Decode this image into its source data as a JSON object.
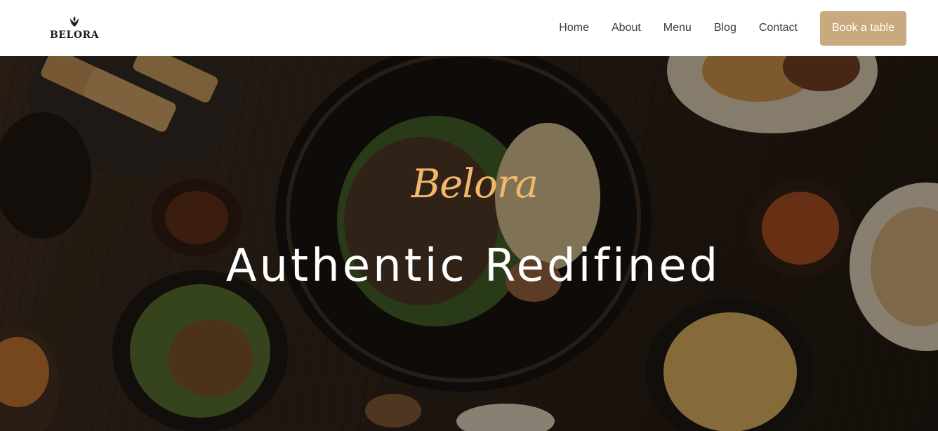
{
  "brand": {
    "name": "BELORA",
    "icon": "tulip-logo-icon"
  },
  "nav": {
    "items": [
      {
        "label": "Home"
      },
      {
        "label": "About"
      },
      {
        "label": "Menu"
      },
      {
        "label": "Blog"
      },
      {
        "label": "Contact"
      }
    ],
    "cta_label": "Book a table"
  },
  "hero": {
    "script_title": "Belora",
    "headline": "Authentic Redifined"
  },
  "colors": {
    "accent": "#c9a97e",
    "script": "#f2b86a",
    "header_bg": "#ffffff",
    "nav_text": "#3b3b3b"
  }
}
